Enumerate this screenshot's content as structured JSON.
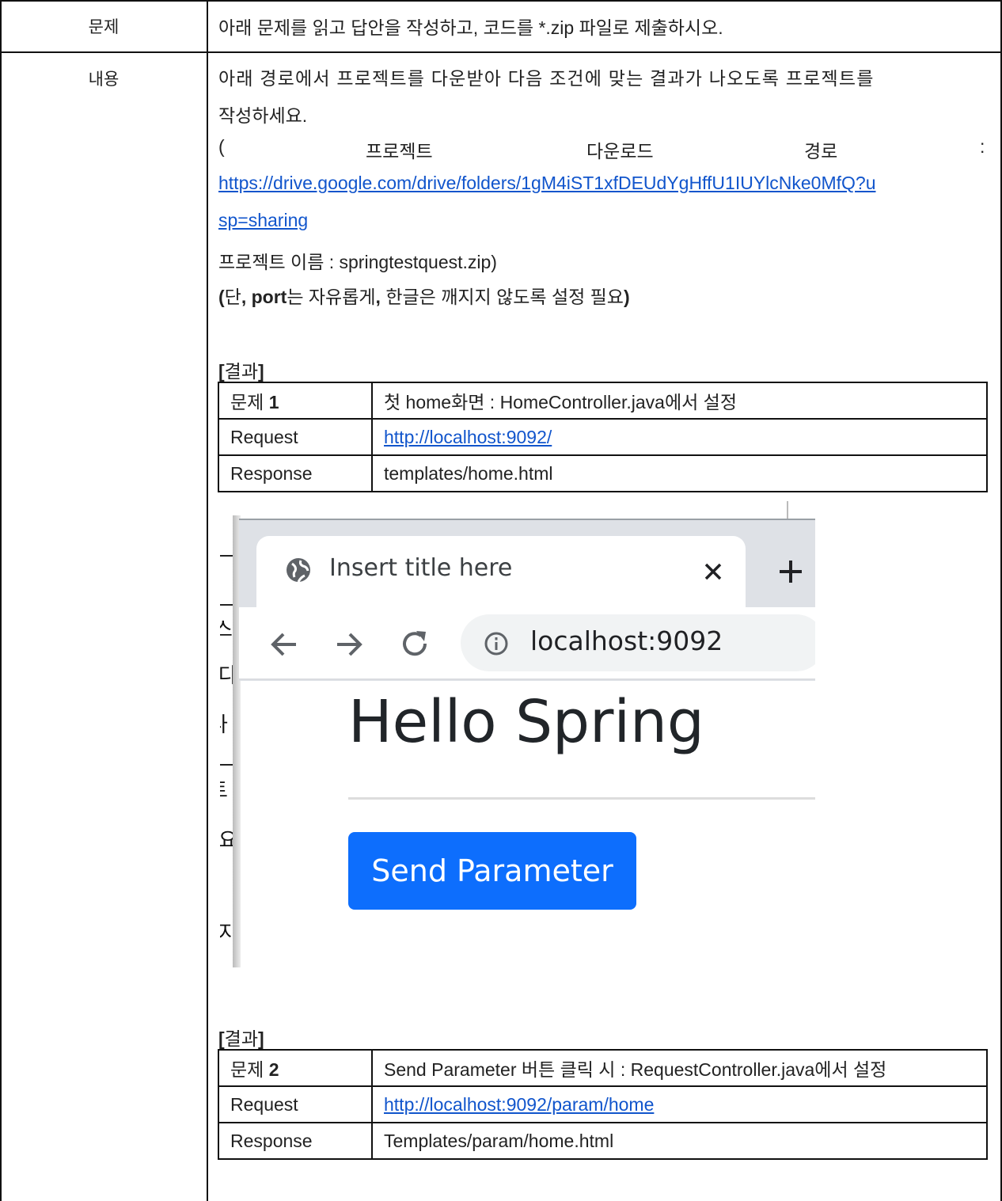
{
  "header_row": {
    "label": "문제",
    "text": "아래 문제를 읽고 답안을 작성하고, 코드를 *.zip 파일로 제출하시오."
  },
  "content_row": {
    "label": "내용",
    "line1": "아래 경로에서 프로젝트를 다운받아 다음 조건에 맞는 결과가 나오도록 프로젝트를",
    "line2": "작성하세요.",
    "line3_paren": "(",
    "line3_a": "프로젝트",
    "line3_b": "다운로드",
    "line3_c": "경로",
    "line3_colon": ":",
    "link_part1": "https://drive.google.com/drive/folders/1gM4iST1xfDEUdYgHffU1IUYlcNke0MfQ?u",
    "link_part2": "sp=sharing",
    "project_name": " 프로젝트 이름 : springtestquest.zip)",
    "note_open": "(",
    "note_dan": "단",
    "note_comma1": ",",
    "note_port": "port",
    "note_mid": "는 자유롭게",
    "note_comma2": ",",
    "note_end": "한글은 깨지지 않도록 설정 필요",
    "note_close": ")"
  },
  "result1": {
    "heading_open": "[",
    "heading": "결과",
    "heading_close": "]",
    "rows": [
      {
        "k": "문제 ",
        "kb": "1",
        "v": "첫 home화면 : HomeController.java에서 설정"
      },
      {
        "k": "Request",
        "v": "http://localhost:9092/"
      },
      {
        "k": "Response",
        "v": "templates/home.html"
      }
    ]
  },
  "browser": {
    "tab_title": "Insert title here",
    "url": "localhost:9092",
    "page_heading": "Hello Spring",
    "button_label": "Send Parameter",
    "side_glyphs": [
      "스",
      "다",
      "나",
      "트",
      "요",
      "지"
    ],
    "accent": "#0d6efd"
  },
  "result2": {
    "heading_open": "[",
    "heading": "결과",
    "heading_close": "]",
    "rows": [
      {
        "k": "문제 ",
        "kb": "2",
        "v": "Send Parameter 버튼 클릭 시 : RequestController.java에서 설정"
      },
      {
        "k": "Request",
        "v": "http://localhost:9092/param/home"
      },
      {
        "k": "Response",
        "v": "Templates/param/home.html"
      }
    ]
  }
}
